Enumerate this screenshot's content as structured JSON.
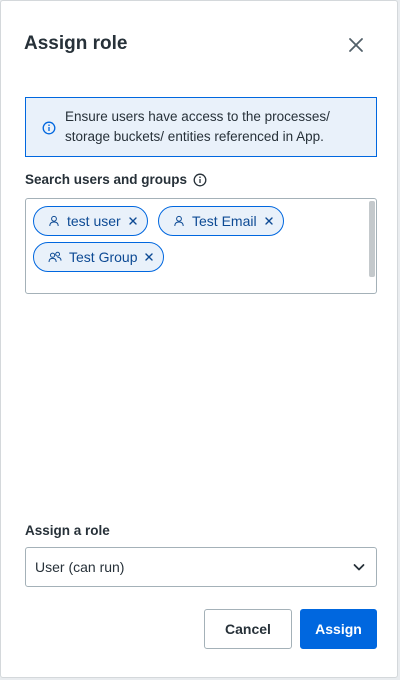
{
  "dialog": {
    "title": "Assign role",
    "close_icon": "close-icon"
  },
  "info": {
    "icon": "info-icon",
    "text": "Ensure users have access to the processes/ storage buckets/ entities referenced in App."
  },
  "search": {
    "label": "Search users and groups",
    "help_icon": "info-icon",
    "chips": [
      {
        "label": "test user",
        "icon": "user-icon"
      },
      {
        "label": "Test Email",
        "icon": "user-icon"
      },
      {
        "label": "Test Group",
        "icon": "group-icon"
      }
    ]
  },
  "role": {
    "label": "Assign a role",
    "selected": "User (can run)",
    "chevron_icon": "chevron-down-icon"
  },
  "actions": {
    "cancel": "Cancel",
    "assign": "Assign"
  },
  "colors": {
    "accent": "#0067df",
    "info_background": "#e9f1fa",
    "chip_text": "#0d4a94"
  }
}
